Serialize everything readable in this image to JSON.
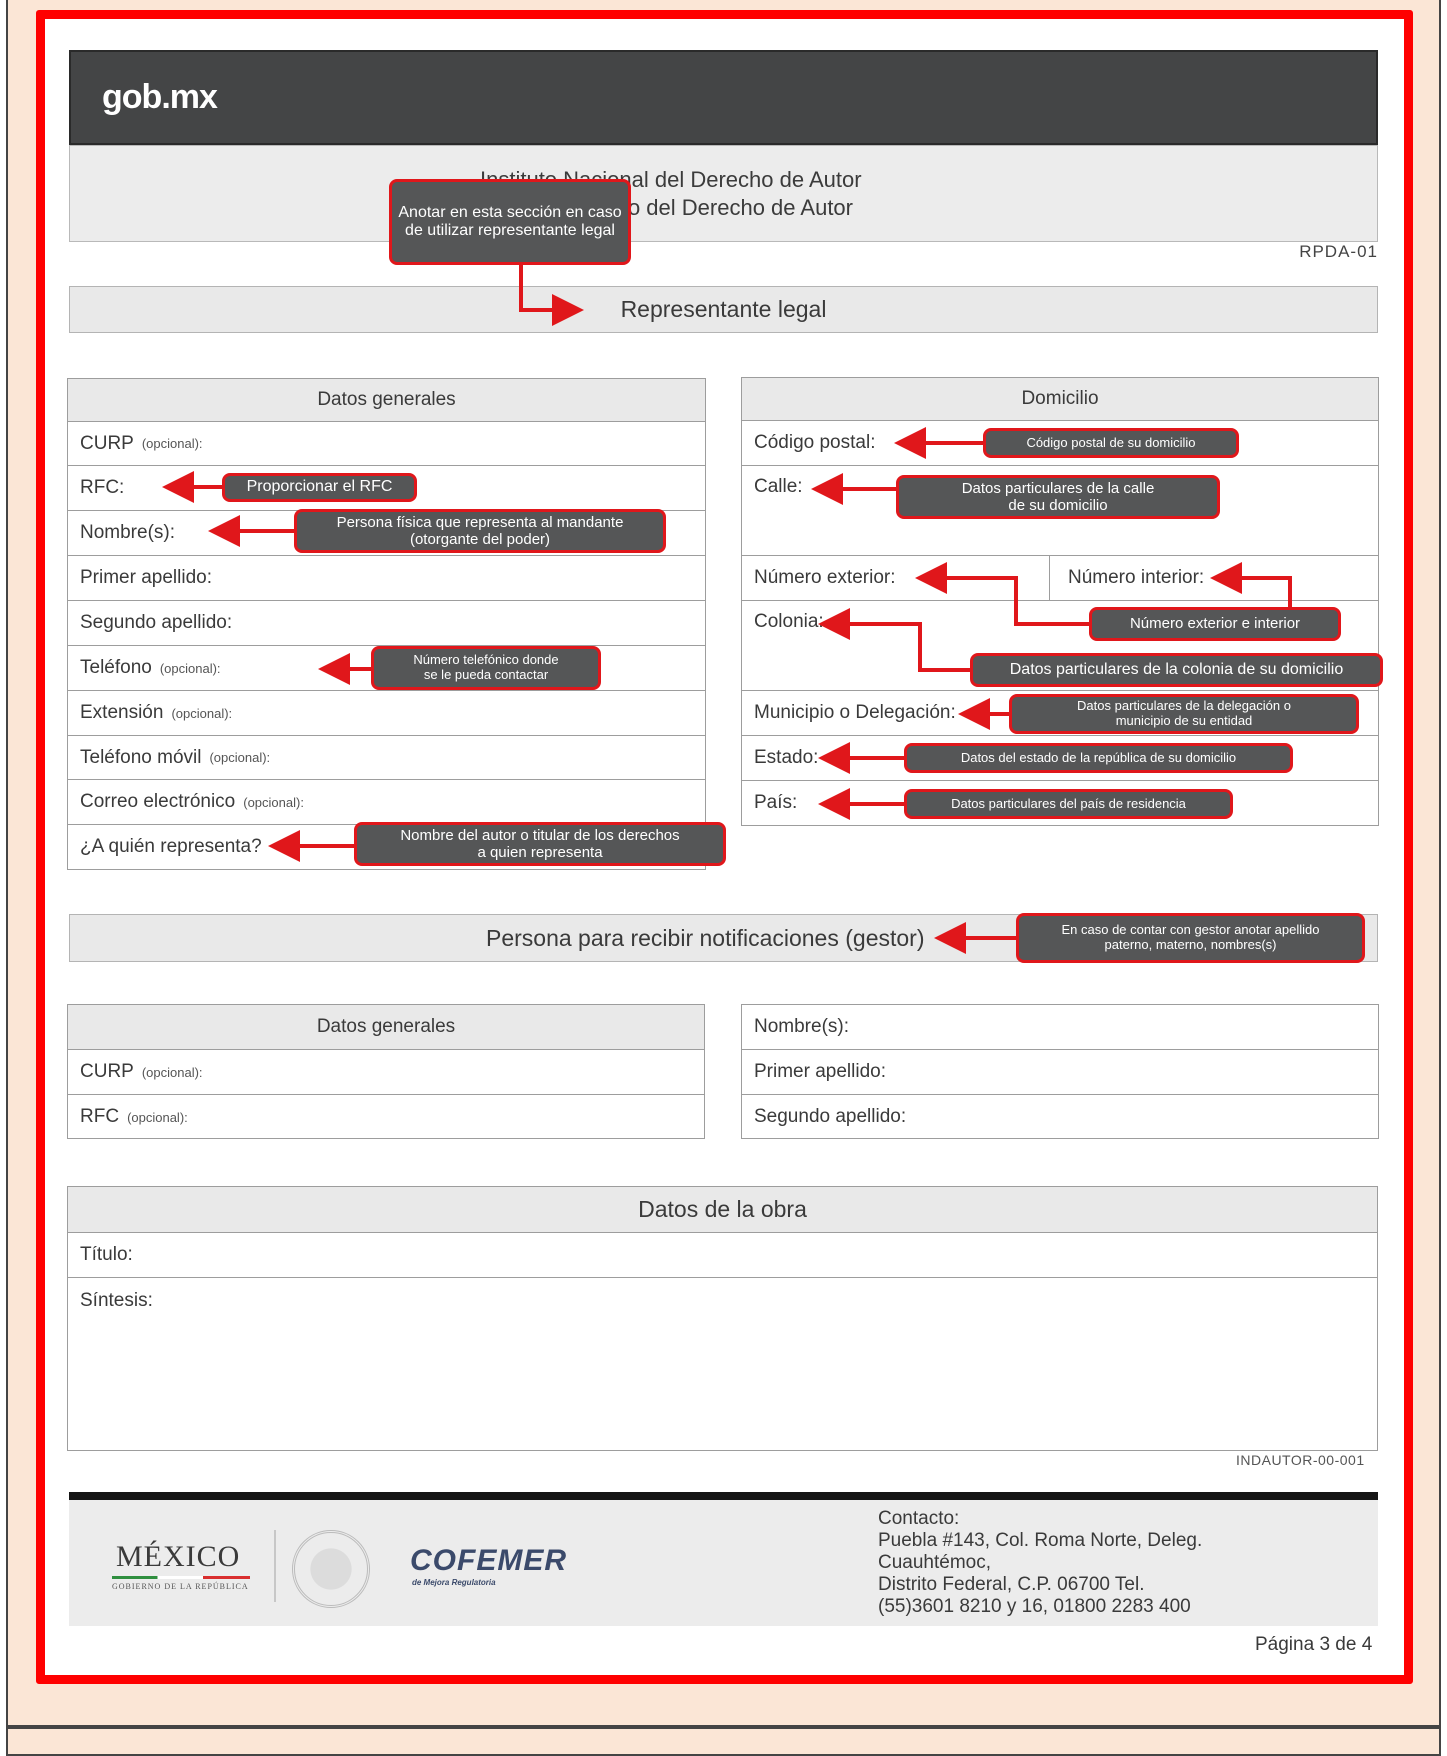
{
  "header": {
    "logo_gob": "gob",
    "logo_dot": ".",
    "logo_mx": "mx",
    "institute_line1": "Instituto Nacional del Derecho de Autor",
    "institute_line2": "Registro Público del Derecho de Autor",
    "form_code": "RPDA-01",
    "callout_representante": "Anotar en esta sección en caso de utilizar representante legal"
  },
  "section_representante": {
    "title": "Representante legal"
  },
  "datos_generales": {
    "heading": "Datos generales",
    "curp": {
      "label": "CURP",
      "optional": "(opcional):"
    },
    "rfc": {
      "label": "RFC:",
      "callout": "Proporcionar el RFC"
    },
    "nombres": {
      "label": "Nombre(s):",
      "callout_line1": "Persona física que representa al mandante",
      "callout_line2": "(otorgante del poder)"
    },
    "primer_apellido": {
      "label": "Primer apellido:"
    },
    "segundo_apellido": {
      "label": "Segundo apellido:"
    },
    "telefono": {
      "label": "Teléfono",
      "optional": "(opcional):",
      "callout_line1": "Número telefónico donde",
      "callout_line2": "se le pueda contactar"
    },
    "extension": {
      "label": "Extensión",
      "optional": "(opcional):"
    },
    "telefono_movil": {
      "label": "Teléfono móvil",
      "optional": "(opcional):"
    },
    "correo": {
      "label": "Correo electrónico",
      "optional": "(opcional):"
    },
    "a_quien": {
      "label": "¿A quién representa?",
      "callout_line1": "Nombre del autor o titular de los derechos",
      "callout_line2": "a quien representa"
    }
  },
  "domicilio": {
    "heading": "Domicilio",
    "codigo_postal": {
      "label": "Código postal:",
      "callout": "Código postal de su domicilio"
    },
    "calle": {
      "label": "Calle:",
      "callout_line1": "Datos particulares de la calle",
      "callout_line2": "de su domicilio"
    },
    "numero_exterior": {
      "label": "Número exterior:"
    },
    "numero_interior": {
      "label": "Número interior:",
      "callout": "Número exterior e interior"
    },
    "colonia": {
      "label": "Colonia:",
      "callout": "Datos particulares de la colonia de su domicilio"
    },
    "municipio": {
      "label": "Municipio o Delegación:",
      "callout_line1": "Datos particulares de la delegación o",
      "callout_line2": "municipio de su entidad"
    },
    "estado": {
      "label": "Estado:",
      "callout": "Datos del estado de la república de su domicilio"
    },
    "pais": {
      "label": "País:",
      "callout": "Datos particulares del país de residencia"
    }
  },
  "section_notificaciones": {
    "title": "Persona para recibir notificaciones (gestor)",
    "callout_line1": "En caso de contar con gestor anotar apellido",
    "callout_line2": "paterno, materno, nombres(s)"
  },
  "gestor_datos_generales": {
    "heading": "Datos generales",
    "curp": {
      "label": "CURP",
      "optional": "(opcional):"
    },
    "rfc": {
      "label": "RFC",
      "optional": "(opcional):"
    }
  },
  "gestor_nombres": {
    "nombres": "Nombre(s):",
    "primer_apellido": "Primer apellido:",
    "segundo_apellido": "Segundo apellido:"
  },
  "datos_obra": {
    "heading": "Datos de la obra",
    "titulo": "Título:",
    "sintesis": "Síntesis:"
  },
  "indautor_code": "INDAUTOR-00-001",
  "footer": {
    "mexico": "MÉXICO",
    "mexico_sub": "GOBIERNO DE LA REPÚBLICA",
    "cofemer": "COFEMER",
    "cofemer_sub": "de Mejora Regulatoria",
    "contact_line1": "Contacto:",
    "contact_line2": "Puebla #143, Col. Roma Norte, Deleg.",
    "contact_line3": "Cuauhtémoc,",
    "contact_line4": "Distrito Federal, C.P. 06700 Tel.",
    "contact_line5": "(55)3601 8210 y 16, 01800 2283 400",
    "page": "Página 3 de 4"
  },
  "colors": {
    "callout_bg": "#555657",
    "accent_red": "#e0171b",
    "frame_red": "#ff0000",
    "header_dark": "#444546"
  }
}
